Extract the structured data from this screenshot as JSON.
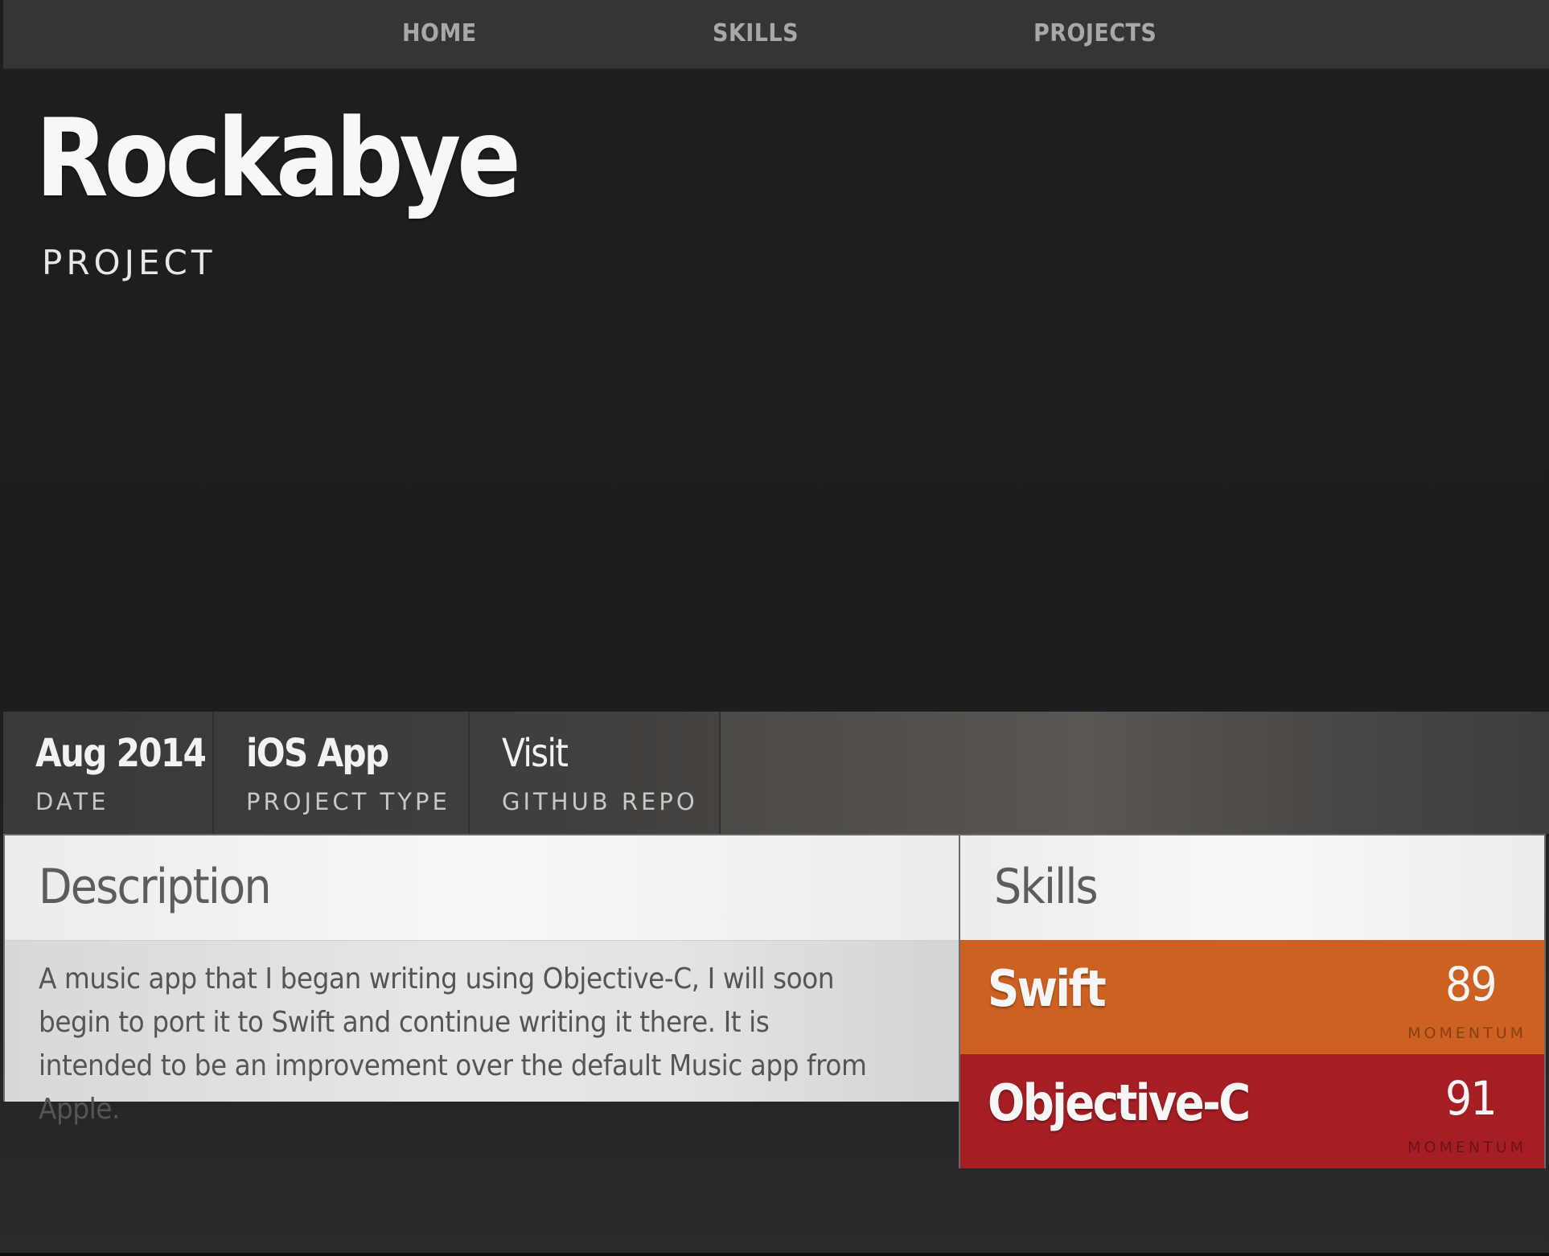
{
  "nav": {
    "items": [
      {
        "label": "HOME"
      },
      {
        "label": "SKILLS"
      },
      {
        "label": "PROJECTS"
      }
    ]
  },
  "hero": {
    "title": "Rockabye",
    "subtitle": "PROJECT"
  },
  "meta": {
    "items": [
      {
        "value": "Aug 2014",
        "label": "DATE"
      },
      {
        "value": "iOS App",
        "label": "PROJECT TYPE"
      },
      {
        "value": "Visit",
        "label": "GITHUB REPO"
      }
    ]
  },
  "description": {
    "heading": "Description",
    "body": "A music app that I began writing using Objective-C, I will soon begin to port it to Swift and continue writing it there. It is intended to be an improvement over the default Music app from Apple."
  },
  "skills": {
    "heading": "Skills",
    "items": [
      {
        "name": "Swift",
        "score": "89",
        "score_label": "MOMENTUM",
        "color": "#cc6121"
      },
      {
        "name": "Objective-C",
        "score": "91",
        "score_label": "MOMENTUM",
        "color": "#a41e24"
      }
    ]
  },
  "colors": {
    "nav_bg": "#353535",
    "page_bg": "#1e1e1e",
    "meta_bg": "#484644",
    "card_head_bg": "#f4f4f4",
    "swift": "#cc6121",
    "objective_c": "#a41e24"
  }
}
